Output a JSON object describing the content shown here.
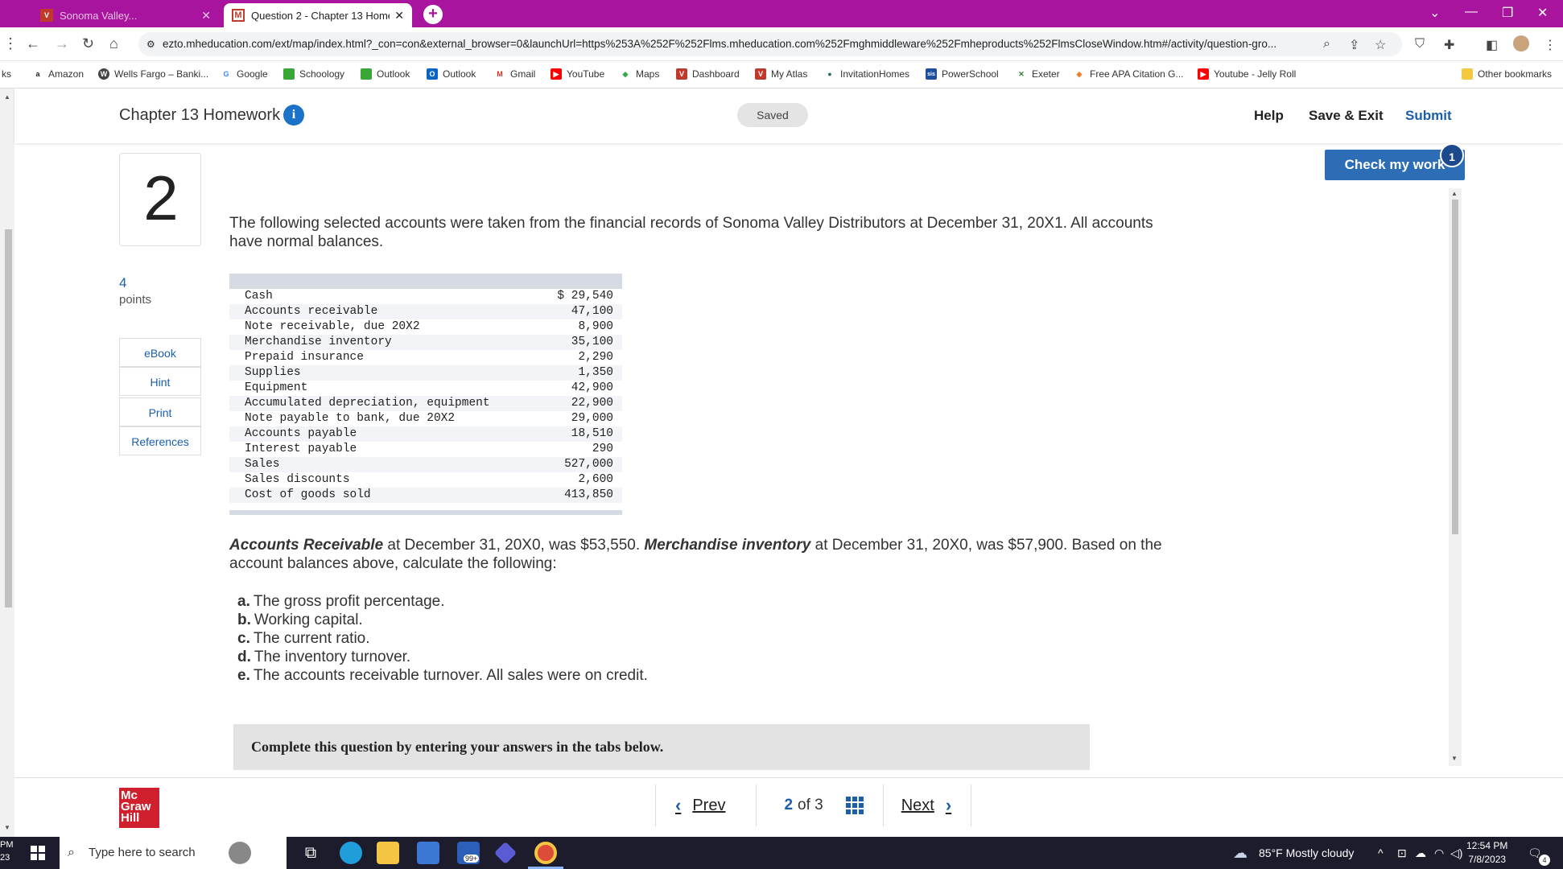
{
  "browser": {
    "tabs": [
      {
        "label": "Sonoma Valley..."
      },
      {
        "label": "Question 2 - Chapter 13 Home"
      }
    ],
    "url": "ezto.mheducation.com/ext/map/index.html?_con=con&external_browser=0&launchUrl=https%253A%252F%252Flms.mheducation.com%252Fmghmiddleware%252Fmheproducts%252FlmsCloseWindow.htm#/activity/question-gro...",
    "bookmarks": [
      {
        "label": "Amazon",
        "color": "#222222",
        "icon": "a"
      },
      {
        "label": "Wells Fargo – Banki...",
        "color": "#444444",
        "icon": "W"
      },
      {
        "label": "Google",
        "color": "#4285f4",
        "icon": "G"
      },
      {
        "label": "Schoology",
        "color": "#3aa637",
        "icon": "S"
      },
      {
        "label": "Outlook",
        "color": "#3aa637",
        "icon": "S"
      },
      {
        "label": "Outlook",
        "color": "#0a64c8",
        "icon": "O"
      },
      {
        "label": "Gmail",
        "color": "#d93025",
        "icon": "M"
      },
      {
        "label": "YouTube",
        "color": "#ff0000",
        "icon": "▶"
      },
      {
        "label": "Maps",
        "color": "#34a853",
        "icon": "◆"
      },
      {
        "label": "Dashboard",
        "color": "#c0392b",
        "icon": "V"
      },
      {
        "label": "My Atlas",
        "color": "#c0392b",
        "icon": "V"
      },
      {
        "label": "InvitationHomes",
        "color": "#2a6f4f",
        "icon": "●"
      },
      {
        "label": "PowerSchool",
        "color": "#1b4f9c",
        "icon": "sis"
      },
      {
        "label": "Exeter",
        "color": "#2e7d32",
        "icon": "✕"
      },
      {
        "label": "Free APA Citation G...",
        "color": "#e87722",
        "icon": "◈"
      },
      {
        "label": "Youtube - Jelly Roll",
        "color": "#ff0000",
        "icon": "▶"
      }
    ],
    "other_bookmarks": "Other bookmarks",
    "bm_cut_label": "ks"
  },
  "header": {
    "title": "Chapter 13 Homework",
    "saved": "Saved",
    "help": "Help",
    "save_exit": "Save & Exit",
    "submit": "Submit"
  },
  "check_work": {
    "label": "Check my work",
    "badge": "1"
  },
  "question": {
    "number": "2",
    "points": "4",
    "points_label": "points",
    "side_buttons": [
      "eBook",
      "Hint",
      "Print",
      "References"
    ],
    "intro": "The following selected accounts were taken from the financial records of Sonoma Valley Distributors at December 31, 20X1. All accounts have normal balances.",
    "accounts": [
      {
        "name": "Cash",
        "amount": "$ 29,540"
      },
      {
        "name": "Accounts receivable",
        "amount": "47,100"
      },
      {
        "name": "Note receivable, due 20X2",
        "amount": "8,900"
      },
      {
        "name": "Merchandise inventory",
        "amount": "35,100"
      },
      {
        "name": "Prepaid insurance",
        "amount": "2,290"
      },
      {
        "name": "Supplies",
        "amount": "1,350"
      },
      {
        "name": "Equipment",
        "amount": "42,900"
      },
      {
        "name": "Accumulated depreciation, equipment",
        "amount": "22,900"
      },
      {
        "name": "Note payable to bank, due 20X2",
        "amount": "29,000"
      },
      {
        "name": "Accounts payable",
        "amount": "18,510"
      },
      {
        "name": "Interest payable",
        "amount": "290"
      },
      {
        "name": "Sales",
        "amount": "527,000"
      },
      {
        "name": "Sales discounts",
        "amount": "2,600"
      },
      {
        "name": "Cost of goods sold",
        "amount": "413,850"
      }
    ],
    "para2": {
      "ar_label": "Accounts Receivable",
      "ar_text": " at December 31, 20X0, was $53,550. ",
      "inv_label": "Merchandise inventory",
      "inv_text": " at December 31, 20X0, was $57,900. Based on the account balances above, calculate the following:"
    },
    "requirements": [
      {
        "letter": "a.",
        "text": "The gross profit percentage."
      },
      {
        "letter": "b.",
        "text": "Working capital."
      },
      {
        "letter": "c.",
        "text": "The current ratio."
      },
      {
        "letter": "d.",
        "text": "The inventory turnover."
      },
      {
        "letter": "e.",
        "text": "The accounts receivable turnover. All sales were on credit."
      }
    ],
    "complete_text": "Complete this question by entering your answers in the tabs below."
  },
  "footer": {
    "logo_lines": [
      "Mc",
      "Graw",
      "Hill"
    ],
    "prev": "Prev",
    "current": "2",
    "of_text": "of 3",
    "next": "Next"
  },
  "taskbar": {
    "search_placeholder": "Type here to search",
    "weather": "85°F  Mostly cloudy",
    "time": "12:54 PM",
    "date": "7/8/2023",
    "mail_badge": "99+",
    "notif_count": "4",
    "left_edge_top": "PM",
    "left_edge_bottom": "23"
  }
}
